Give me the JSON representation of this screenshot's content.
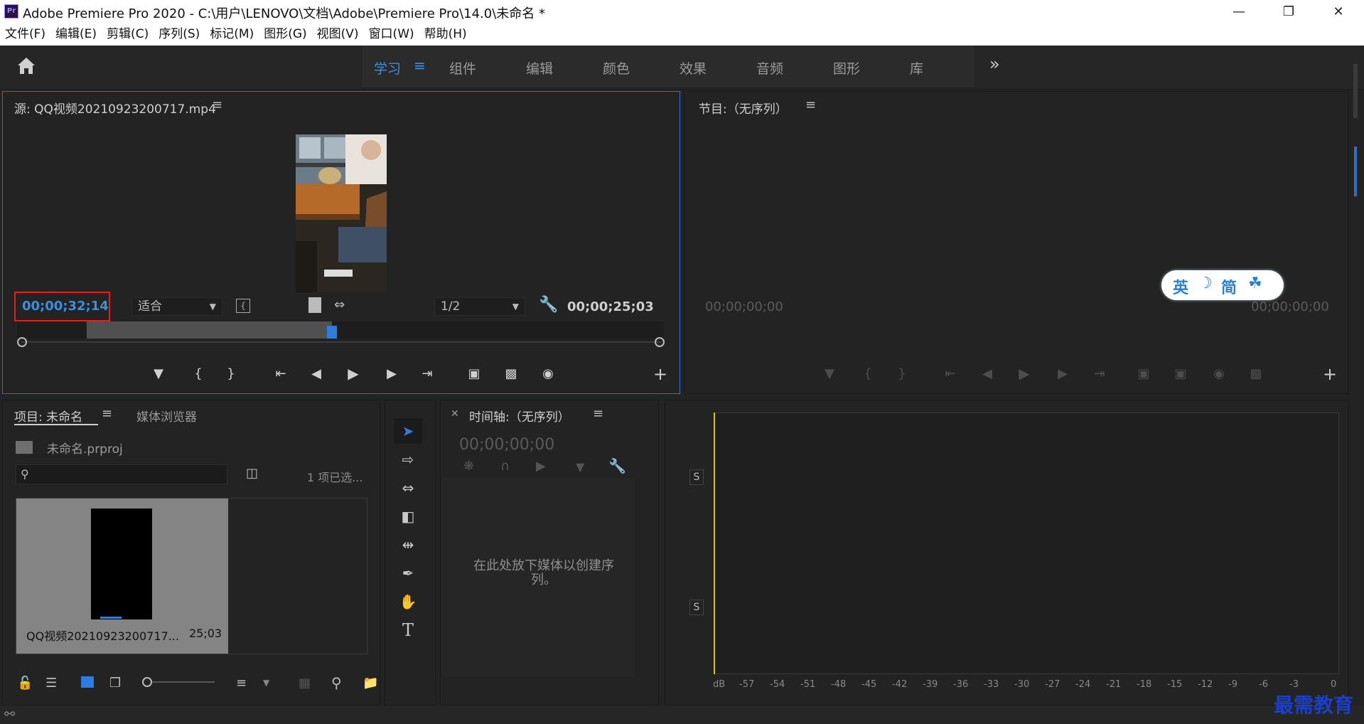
{
  "window": {
    "title": "Adobe Premiere Pro 2020 - C:\\用户\\LENOVO\\文档\\Adobe\\Premiere Pro\\14.0\\未命名 *",
    "app_icon": "Pr"
  },
  "menu": [
    "文件(F)",
    "编辑(E)",
    "剪辑(C)",
    "序列(S)",
    "标记(M)",
    "图形(G)",
    "视图(V)",
    "窗口(W)",
    "帮助(H)"
  ],
  "workspaces": {
    "tabs": [
      "学习",
      "组件",
      "编辑",
      "颜色",
      "效果",
      "音频",
      "图形",
      "库"
    ],
    "active": "学习",
    "more": "»"
  },
  "source_monitor": {
    "title": "源: QQ视频20210923200717.mp4",
    "playhead_time": "00;00;32;14",
    "zoom": "适合",
    "resolution": "1/2",
    "duration": "00;00;25;03",
    "accent_color": "#2d6fc6",
    "highlight_color": "#e02020"
  },
  "program_monitor": {
    "title": "节目:（无序列）",
    "time_left": "00;00;00;00",
    "time_right": "00;00;00;00"
  },
  "ime_toolbar": {
    "lang": "英",
    "mode": "简"
  },
  "project_panel": {
    "tab_project": "项目: 未命名",
    "tab_media": "媒体浏览器",
    "file_name": "未命名.prproj",
    "selection_info": "1 项已选...",
    "search_placeholder": "",
    "clip_name": "QQ视频20210923200717...",
    "clip_duration": "25;03"
  },
  "timeline_panel": {
    "title": "时间轴:（无序列）",
    "timecode": "00;00;00;00",
    "empty_message": "在此处放下媒体以创建序列。"
  },
  "audio_meter": {
    "label_s": "S",
    "scale": [
      "dB",
      "-57",
      "-54",
      "-51",
      "-48",
      "-45",
      "-42",
      "-39",
      "-36",
      "-33",
      "-30",
      "-27",
      "-24",
      "-21",
      "-18",
      "-15",
      "-12",
      "-9",
      "-6",
      "-3",
      "0"
    ]
  },
  "watermark": "最需教育"
}
